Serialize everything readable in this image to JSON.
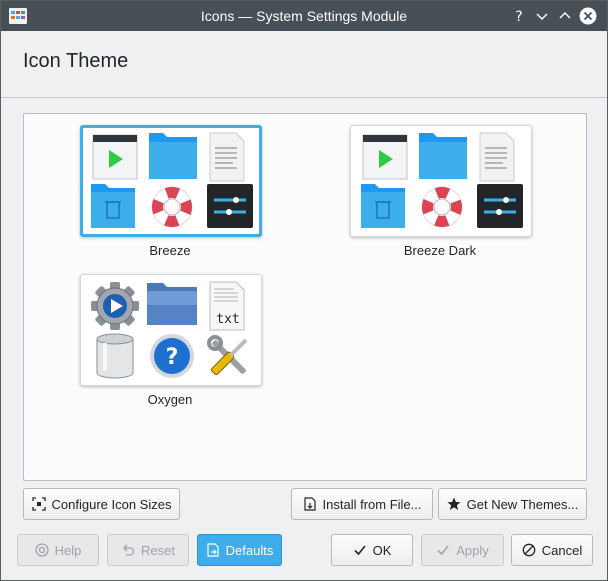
{
  "window": {
    "title": "Icons — System Settings Module"
  },
  "heading": "Icon Theme",
  "themes": [
    {
      "name": "Breeze",
      "selected": true
    },
    {
      "name": "Breeze Dark",
      "selected": false
    },
    {
      "name": "Oxygen",
      "selected": false
    }
  ],
  "actions": {
    "configure_sizes": "Configure Icon Sizes",
    "install_from_file": "Install from File...",
    "get_new_themes": "Get New Themes..."
  },
  "dialog_buttons": {
    "help": "Help",
    "reset": "Reset",
    "defaults": "Defaults",
    "ok": "OK",
    "apply": "Apply",
    "cancel": "Cancel"
  },
  "colors": {
    "titlebar": "#475057",
    "accent": "#3daee9",
    "background": "#eff0f1"
  }
}
